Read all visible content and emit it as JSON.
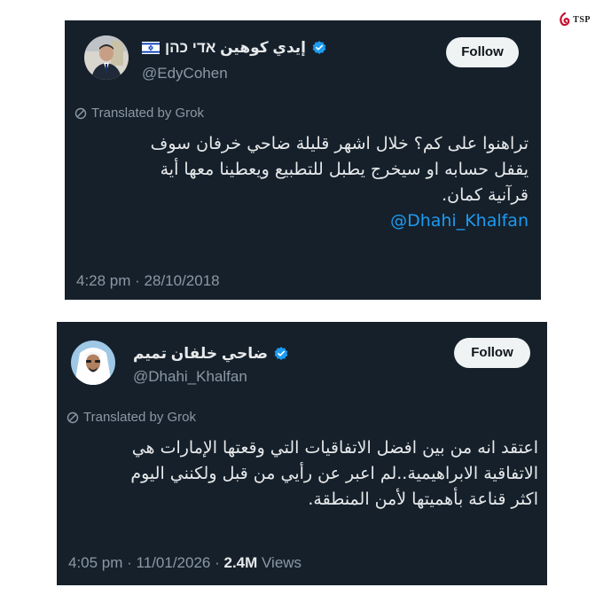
{
  "brand": {
    "text": "TSP"
  },
  "tweets": [
    {
      "name": "إيدي كوهين אדי כהן",
      "handle": "@EdyCohen",
      "follow_label": "Follow",
      "translated_label": "Translated by Grok",
      "body_lines": [
        "تراهنوا على كم؟ خلال اشهر قليلة ضاحي خرفان سوف",
        "يقفل حسابه او سيخرج يطبل للتطبيع ويعطينا معها أية",
        "قرآنية كمان."
      ],
      "mention": "@Dhahi_Khalfan",
      "time": "4:28 pm",
      "date": "28/10/2018",
      "accent_color": "#1d9bf0"
    },
    {
      "name": "ضاحي خلفان تميم",
      "handle": "@Dhahi_Khalfan",
      "follow_label": "Follow",
      "translated_label": "Translated by Grok",
      "body_lines": [
        "اعتقد انه من بين افضل الاتفاقيات التي وقعتها الإمارات هي",
        "الاتفاقية الابراهيمية..لم اعبر عن رأيي من قبل ولكنني اليوم",
        "اكثر قناعة بأهميتها لأمن المنطقة."
      ],
      "time": "4:05 pm",
      "date": "11/01/2026",
      "views_count": "2.4M",
      "views_label": "Views"
    }
  ]
}
